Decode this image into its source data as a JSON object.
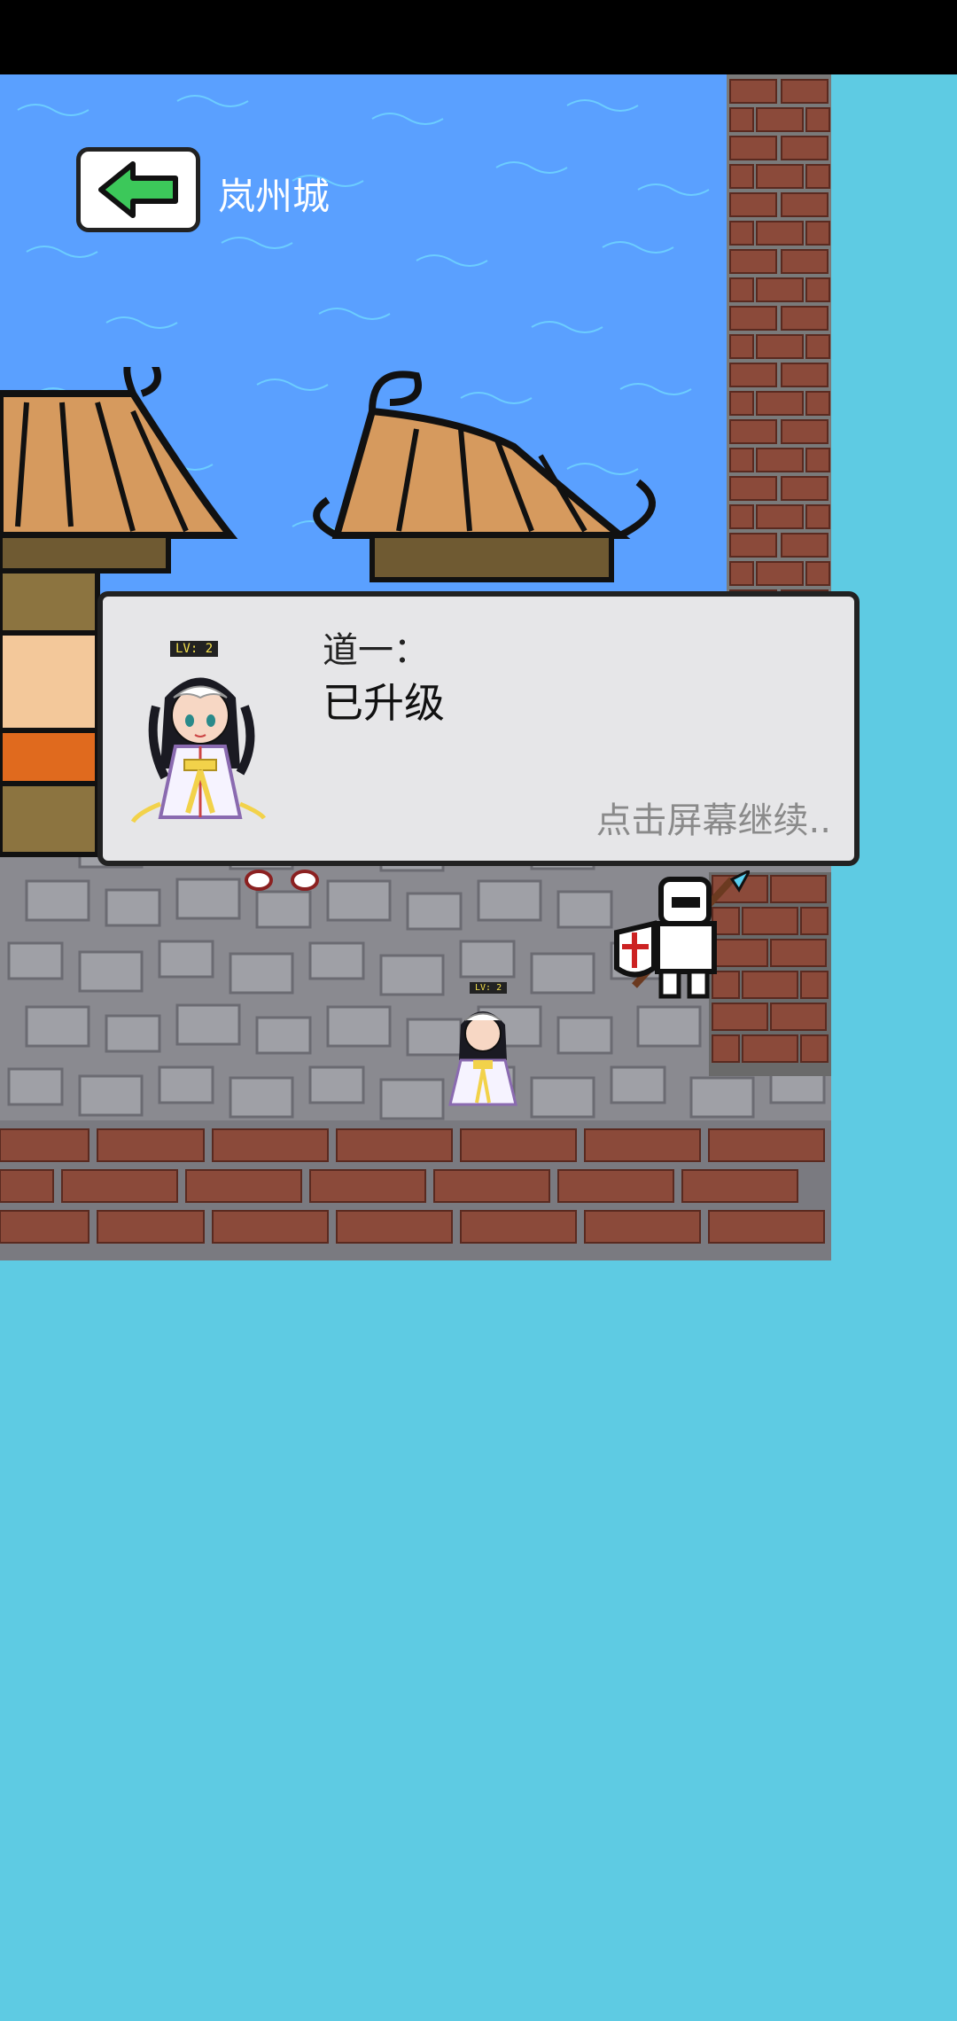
{
  "header": {
    "back_icon": "green-left-arrow-icon",
    "location": "岚州城"
  },
  "dialog": {
    "speaker": "道一：",
    "message": "已升级",
    "continue_hint": "点击屏幕继续..",
    "portrait_level": "LV: 2"
  },
  "characters": {
    "player_level": "LV: 2"
  },
  "colors": {
    "water": "#5aa0ff",
    "sky": "#5ecbe3",
    "brick": "#8b4a3a",
    "arrow_green": "#3cc85a"
  }
}
